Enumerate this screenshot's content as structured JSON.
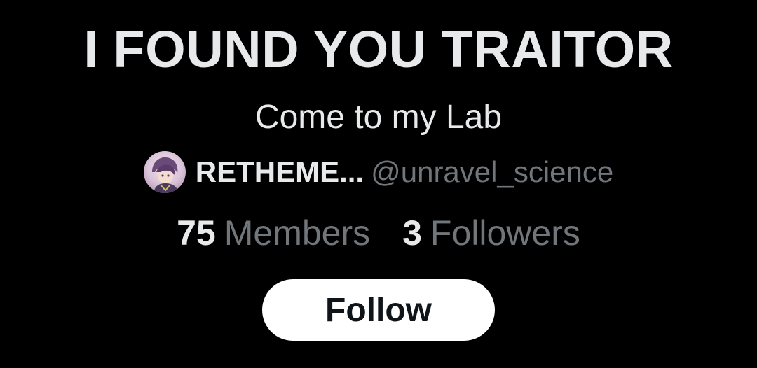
{
  "community": {
    "title": "I FOUND YOU TRAITOR",
    "description": "Come to my Lab"
  },
  "owner": {
    "avatar_icon": "user-avatar-icon",
    "display_name": "RETHEME...",
    "handle": "@unravel_science"
  },
  "stats": [
    {
      "count": "75",
      "label": "Members"
    },
    {
      "count": "3",
      "label": "Followers"
    }
  ],
  "actions": {
    "follow_label": "Follow"
  },
  "colors": {
    "background": "#000000",
    "primary_text": "#e7e9ea",
    "secondary_text": "#71767b",
    "button_bg": "#ffffff",
    "button_text": "#0f1419"
  }
}
